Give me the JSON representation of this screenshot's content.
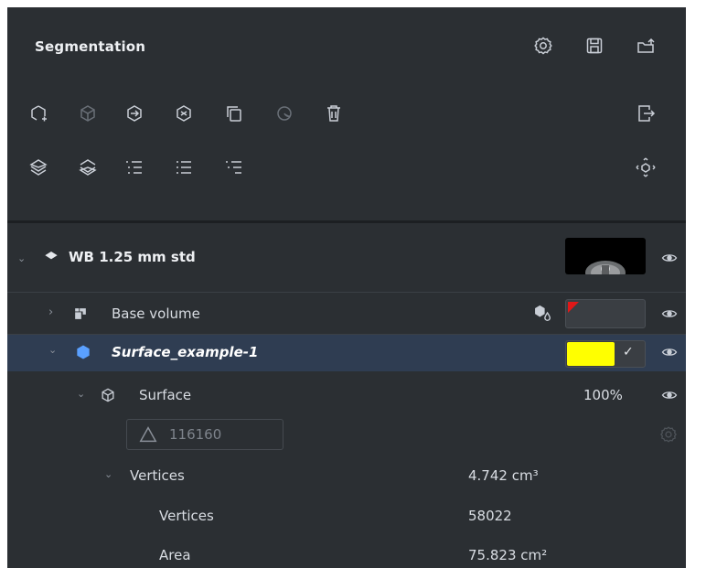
{
  "panel": {
    "title": "Segmentation",
    "header_icons": [
      "gear-icon",
      "save-icon",
      "export-icon"
    ],
    "toolbar_row1": [
      "add-segment-icon",
      "volume-icon",
      "import-volume-icon",
      "merge-volume-icon",
      "duplicate-icon",
      "boolean-icon",
      "delete-icon",
      "exit-icon"
    ],
    "toolbar_row2": [
      "layers-up-icon",
      "layers-down-icon",
      "list-indent-icon",
      "list-icon",
      "list-collapse-icon",
      "move-icon"
    ]
  },
  "tree": {
    "series": {
      "label": "WB 1.25 mm std",
      "visibility": "eye-icon"
    },
    "base_volume": {
      "label": "Base volume",
      "visibility": "eye-icon",
      "swatch_color": "#3d4247",
      "corner_color": "#e01818"
    },
    "surface_example": {
      "label": "Surface_example-1",
      "swatch_color": "#ffff00",
      "check": "✓",
      "visibility": "eye-icon"
    },
    "surface": {
      "label": "Surface",
      "opacity": "100%",
      "visibility": "eye-icon"
    },
    "triangles": {
      "count": "116160"
    },
    "vertices_group": {
      "label": "Vertices",
      "value": "4.742 cm³"
    },
    "vertices": {
      "label": "Vertices",
      "value": "58022"
    },
    "area": {
      "label": "Area",
      "value": "75.823 cm²"
    }
  },
  "colors": {
    "panel_bg": "#2b2f33",
    "selected_row": "#2f3d52",
    "accent_blue": "#5aa0ff",
    "icon": "#c9ced6",
    "icon_disabled": "#6a7078"
  }
}
